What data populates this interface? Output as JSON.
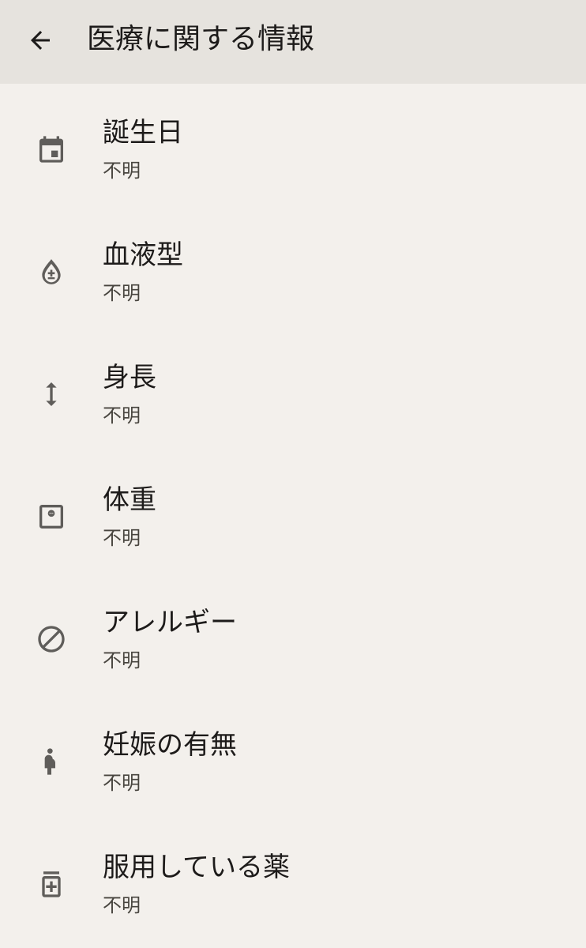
{
  "header": {
    "title": "医療に関する情報"
  },
  "colors": {
    "app_bar": "#e6e3de",
    "background": "#f3f0ec",
    "icon": "#5f5d5a"
  },
  "items": [
    {
      "icon": "calendar-icon",
      "label": "誕生日",
      "value": "不明"
    },
    {
      "icon": "blood-type-icon",
      "label": "血液型",
      "value": "不明"
    },
    {
      "icon": "height-icon",
      "label": "身長",
      "value": "不明"
    },
    {
      "icon": "scale-icon",
      "label": "体重",
      "value": "不明"
    },
    {
      "icon": "block-icon",
      "label": "アレルギー",
      "value": "不明"
    },
    {
      "icon": "pregnant-icon",
      "label": "妊娠の有無",
      "value": "不明"
    },
    {
      "icon": "medication-icon",
      "label": "服用している薬",
      "value": "不明"
    }
  ]
}
